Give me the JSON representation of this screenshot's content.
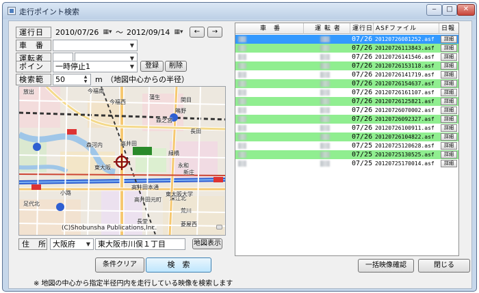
{
  "window": {
    "title": "走行ポイント検索",
    "min": "‒",
    "max": "□",
    "close": "✕"
  },
  "search": {
    "period_label": "運行日",
    "date_from": "2010/07/26",
    "date_sep": "～",
    "date_to": "2012/09/14",
    "prev": "←",
    "next": "→",
    "vehicle_label": "車　番",
    "vehicle_value": "",
    "driver_label": "運転者",
    "driver_value": "",
    "point_label": "ポイント",
    "point_value": "一時停止1",
    "register_btn": "登録",
    "delete_btn": "削除",
    "range_label": "検索範囲",
    "range_value": "50",
    "range_unit": "m",
    "range_note": "（地図中心からの半径）"
  },
  "map": {
    "copyright": "(C)Shobunsha Publications,Inc.",
    "labels": [
      {
        "t": "放出"
      },
      {
        "t": "今福南"
      },
      {
        "t": "今福西"
      },
      {
        "t": "蒲生"
      },
      {
        "t": "関目"
      },
      {
        "t": "鴫野"
      },
      {
        "t": "森河内"
      },
      {
        "t": "高井田"
      },
      {
        "t": "長田"
      },
      {
        "t": "永和"
      },
      {
        "t": "東大阪"
      },
      {
        "t": "深江北"
      },
      {
        "t": "高井田元町"
      },
      {
        "t": "足代北"
      },
      {
        "t": "長堂"
      },
      {
        "t": "荒川"
      },
      {
        "t": "東大阪大学"
      },
      {
        "t": "菱屋西"
      },
      {
        "t": "小路"
      },
      {
        "t": "森之宮"
      },
      {
        "t": "緑橋"
      },
      {
        "t": "新庄"
      },
      {
        "t": "高井田本通"
      }
    ],
    "roads": [
      "15",
      "13",
      "175"
    ]
  },
  "address": {
    "label": "住　所",
    "prefecture": "大阪府",
    "city": "東大阪市川俣１丁目",
    "show_map_btn": "地図表示"
  },
  "actions": {
    "clear_btn": "条件クリア",
    "search_btn": "検　索",
    "note": "※ 地図の中心から指定半径円内を走行している映像を検索します",
    "confirm_btn": "一括映像確認",
    "close_btn": "閉じる"
  },
  "table": {
    "headers": [
      "車　番",
      "運 転 者",
      "運行日",
      "ASFファイル",
      "日報"
    ],
    "rows": [
      {
        "date": "07/26",
        "file": "20120726081252.asf",
        "detail": "詳細",
        "selected": true
      },
      {
        "date": "07/26",
        "file": "20120726113843.asf",
        "detail": "詳細",
        "selected": false
      },
      {
        "date": "07/26",
        "file": "20120726141546.asf",
        "detail": "詳細",
        "selected": false
      },
      {
        "date": "07/26",
        "file": "20120726153118.asf",
        "detail": "詳細",
        "selected": false
      },
      {
        "date": "07/26",
        "file": "20120726141719.asf",
        "detail": "詳細",
        "selected": false
      },
      {
        "date": "07/26",
        "file": "20120726154637.asf",
        "detail": "詳細",
        "selected": false
      },
      {
        "date": "07/26",
        "file": "20120726161107.asf",
        "detail": "詳細",
        "selected": false
      },
      {
        "date": "07/26",
        "file": "20120726125821.asf",
        "detail": "詳細",
        "selected": false
      },
      {
        "date": "07/26",
        "file": "20120726070002.asf",
        "detail": "詳細",
        "selected": false
      },
      {
        "date": "07/26",
        "file": "20120726092327.asf",
        "detail": "詳細",
        "selected": false
      },
      {
        "date": "07/26",
        "file": "20120726100911.asf",
        "detail": "詳細",
        "selected": false
      },
      {
        "date": "07/26",
        "file": "20120726104822.asf",
        "detail": "詳細",
        "selected": false
      },
      {
        "date": "07/25",
        "file": "20120725120628.asf",
        "detail": "詳細",
        "selected": false
      },
      {
        "date": "07/25",
        "file": "20120725130525.asf",
        "detail": "詳細",
        "selected": false
      },
      {
        "date": "07/25",
        "file": "20120725170014.asf",
        "detail": "詳細",
        "selected": false
      }
    ]
  },
  "colors": {
    "row_even": "#ffffff",
    "row_odd": "#90ee90",
    "selected": "#3399ff"
  },
  "icons": {
    "calendar": "calendar-icon",
    "crosshair": "crosshair-icon"
  }
}
